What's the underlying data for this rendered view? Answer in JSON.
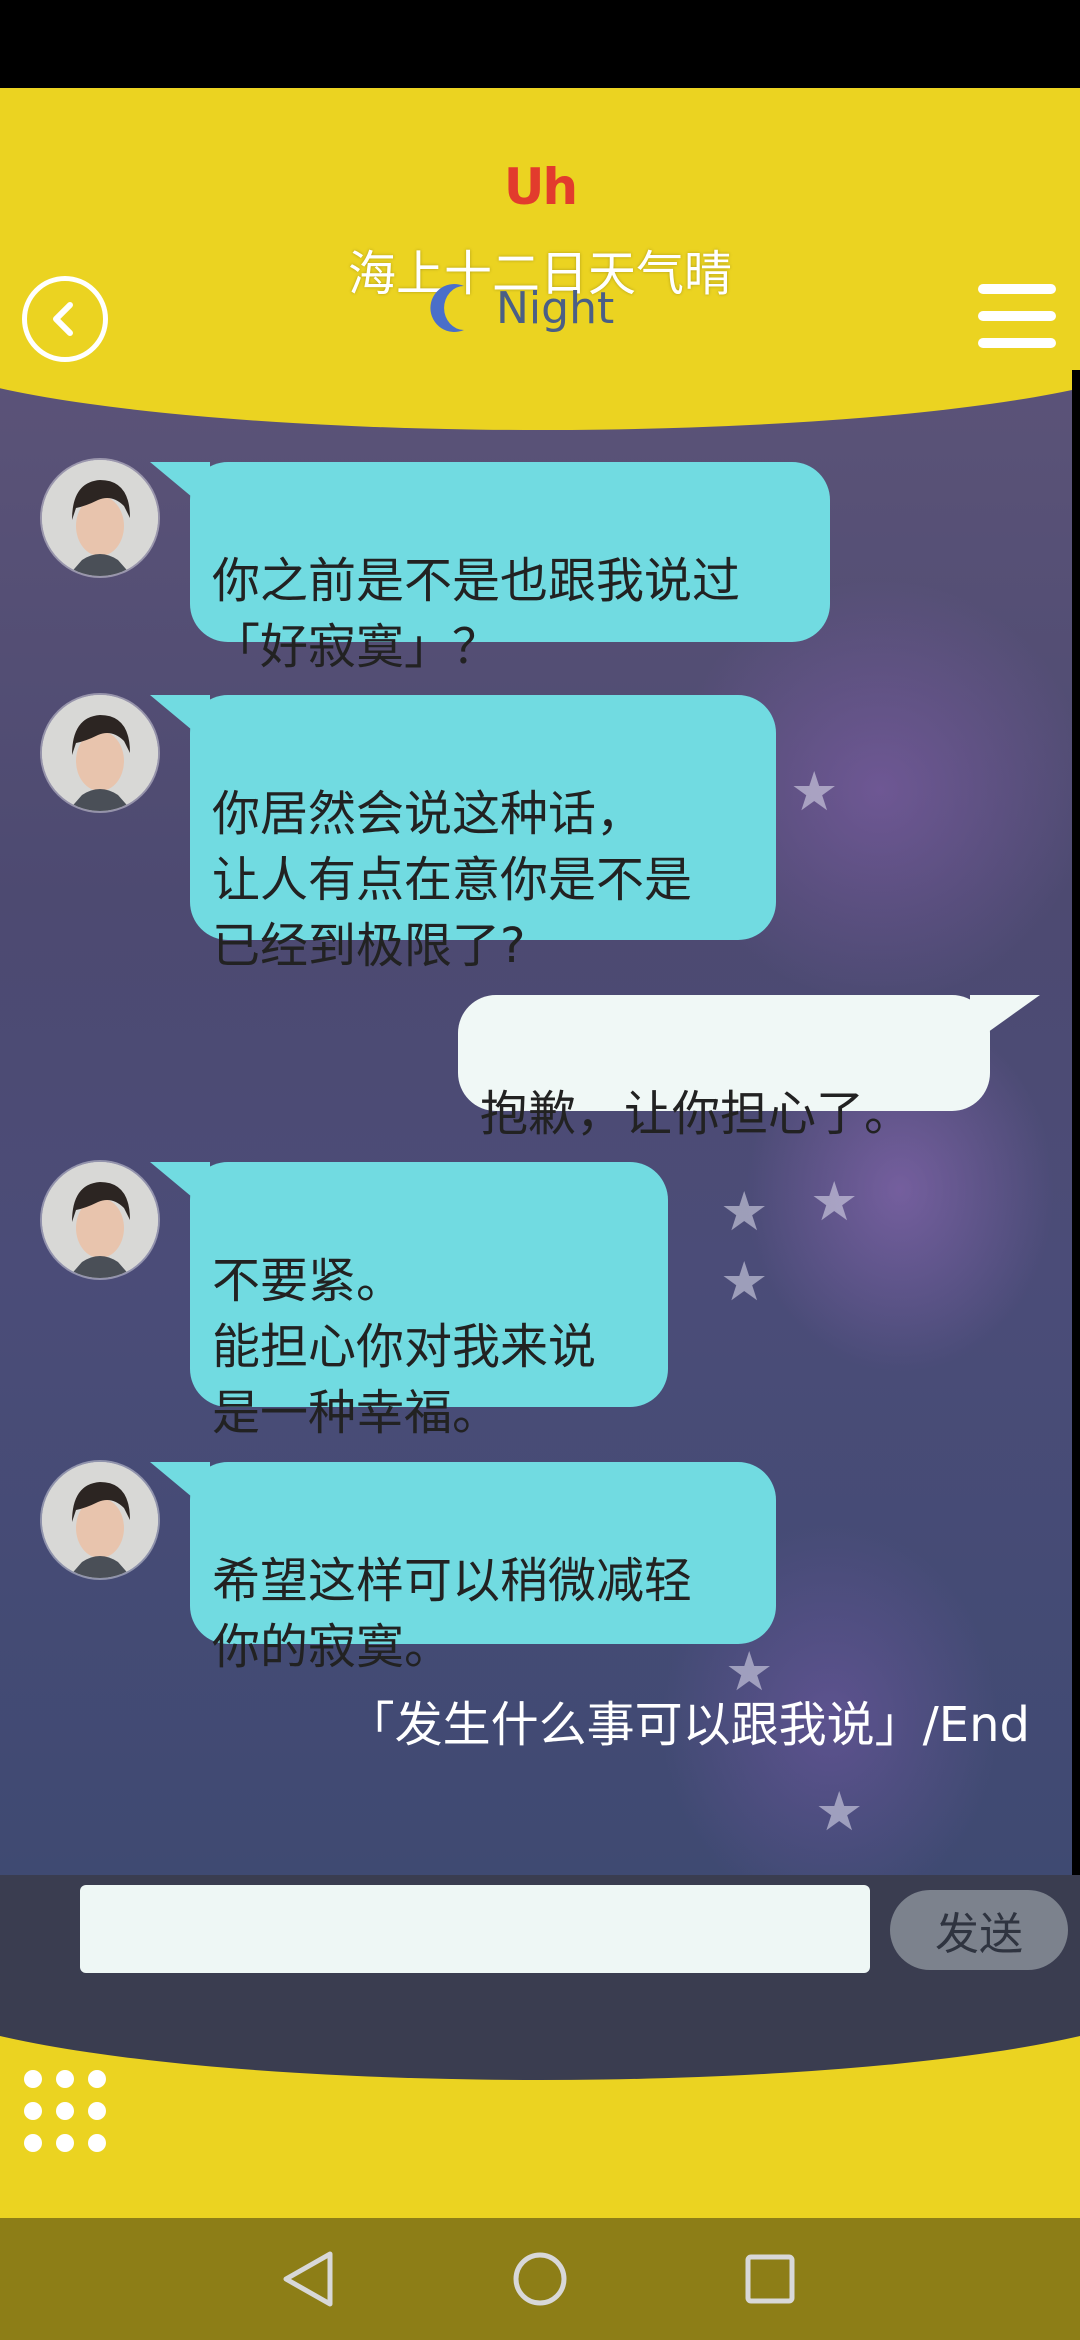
{
  "header": {
    "brand": "Uh",
    "title": "海上十二日天气晴",
    "time_of_day": "Night",
    "moon_color": "#4a6fc9",
    "accent_yellow": "#ebd321"
  },
  "messages": [
    {
      "sender": "character",
      "text": "你之前是不是也跟我说过\n「好寂寞」？"
    },
    {
      "sender": "character",
      "text": "你居然会说这种话，\n让人有点在意你是不是\n已经到极限了?"
    },
    {
      "sender": "me",
      "text": "抱歉，让你担心了。"
    },
    {
      "sender": "character",
      "text": "不要紧。\n能担心你对我来说\n是一种幸福。"
    },
    {
      "sender": "character",
      "text": "希望这样可以稍微减轻\n你的寂寞。"
    }
  ],
  "end_line": "「发生什么事可以跟我说」/End",
  "composer": {
    "input_value": "",
    "send_label": "发送"
  },
  "icons": {
    "back": "back-arrow-icon",
    "menu": "hamburger-menu-icon",
    "grid": "dots-grid-icon",
    "nav_back": "nav-back-icon",
    "nav_home": "nav-home-icon",
    "nav_recents": "nav-recents-icon"
  }
}
